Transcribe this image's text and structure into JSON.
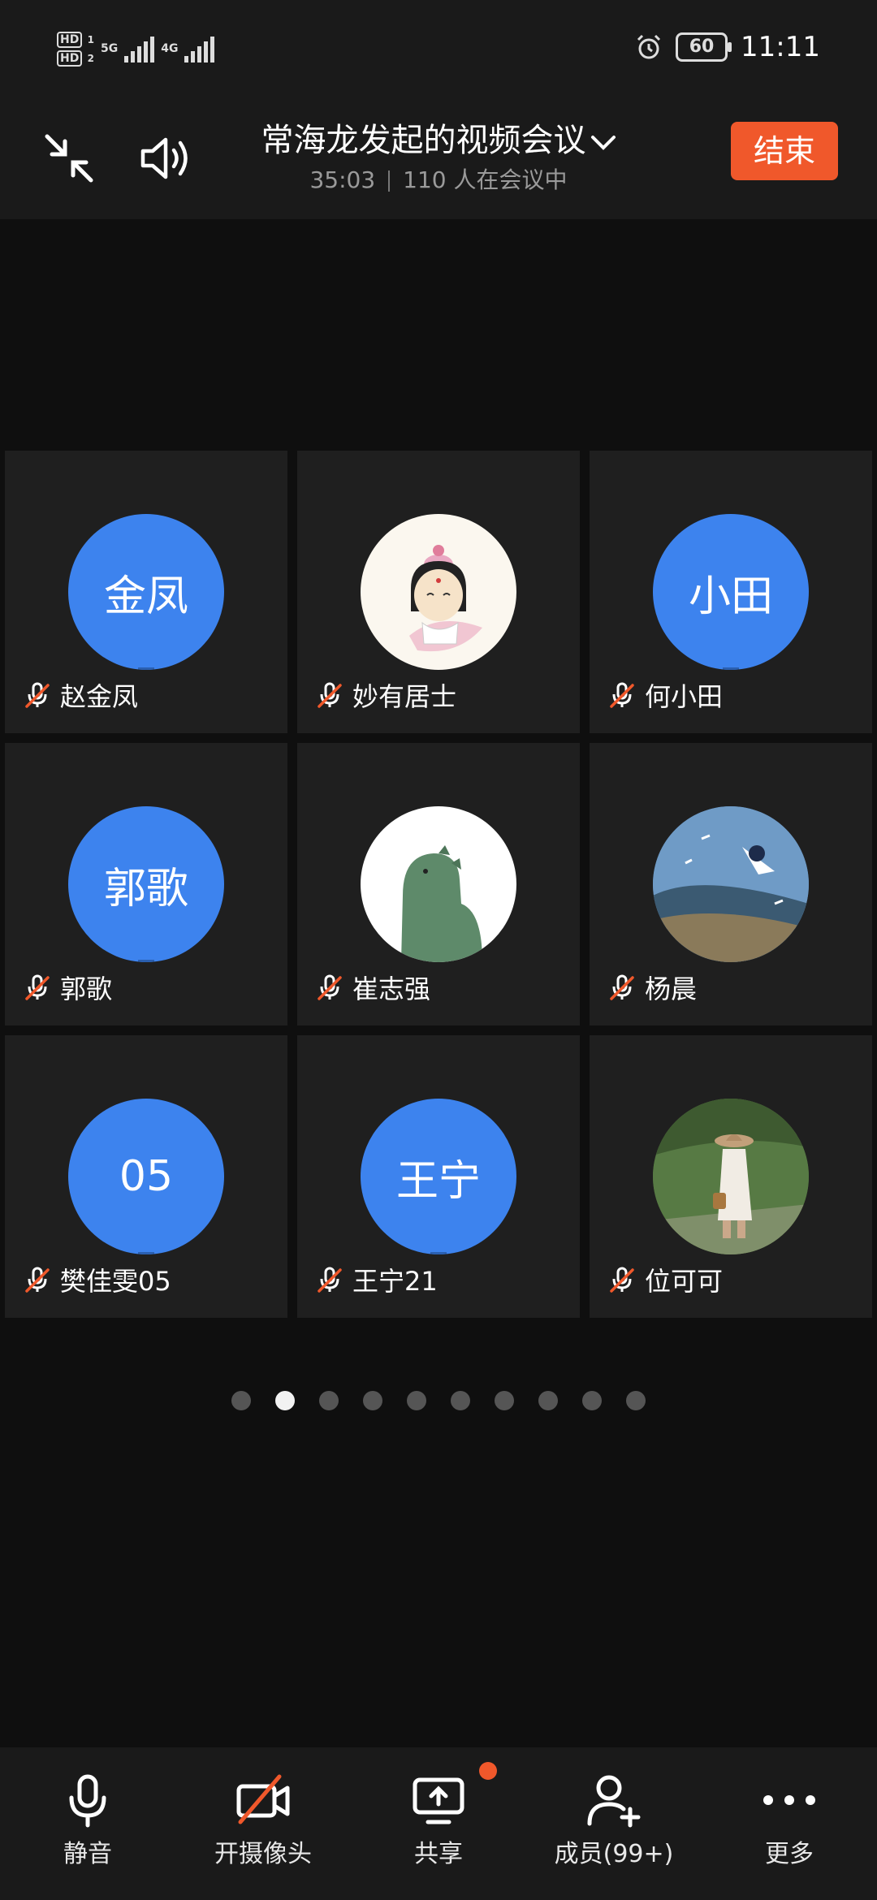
{
  "status_bar": {
    "time": "11:11",
    "battery": "60",
    "sim1": "HD",
    "sim2": "HD",
    "net1": "5G",
    "net2": "4G"
  },
  "header": {
    "title": "常海龙发起的视频会议",
    "duration": "35:03",
    "participants": "110 人在会议中",
    "end_label": "结束"
  },
  "participants": [
    {
      "name": "赵金凤",
      "avatar_text": "金凤",
      "muted": true
    },
    {
      "name": "妙有居士",
      "avatar_text": "",
      "muted": true
    },
    {
      "name": "何小田",
      "avatar_text": "小田",
      "muted": true
    },
    {
      "name": "郭歌",
      "avatar_text": "郭歌",
      "muted": true
    },
    {
      "name": "崔志强",
      "avatar_text": "",
      "muted": true
    },
    {
      "name": "杨晨",
      "avatar_text": "",
      "muted": true
    },
    {
      "name": "樊佳雯05",
      "avatar_text": "05",
      "muted": true
    },
    {
      "name": "王宁21",
      "avatar_text": "王宁",
      "muted": true
    },
    {
      "name": "位可可",
      "avatar_text": "",
      "muted": true
    }
  ],
  "pager": {
    "total": 10,
    "current": 2
  },
  "toolbar": {
    "mute_label": "静音",
    "camera_label": "开摄像头",
    "share_label": "共享",
    "members_label": "成员(99+)",
    "more_label": "更多"
  },
  "colors": {
    "accent": "#f0582b",
    "avatar_blue": "#3d83ee",
    "tile_bg": "#1f1f1f",
    "background": "#0f0f0f"
  }
}
